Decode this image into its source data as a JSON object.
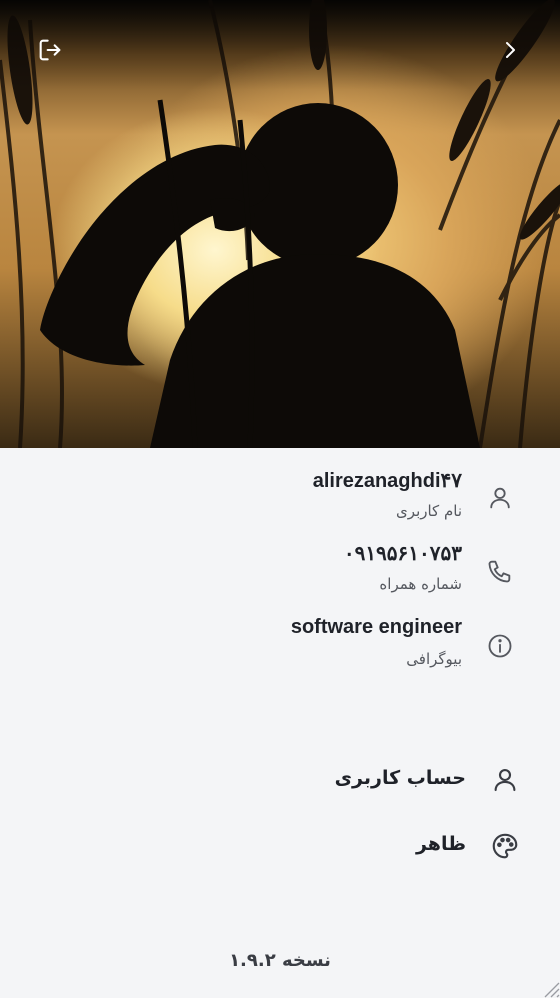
{
  "header": {
    "logout_icon": "logout-icon",
    "forward_icon": "chevron-right-icon"
  },
  "profile": {
    "username": {
      "value": "alirezanaghdi۴۷",
      "label": "نام کاربری",
      "icon": "user-icon"
    },
    "phone": {
      "value": "۰۹۱۹۵۶۱۰۷۵۳",
      "label": "شماره همراه",
      "icon": "phone-icon"
    },
    "bio": {
      "value": "software engineer",
      "label": "بیوگرافی",
      "icon": "info-icon"
    }
  },
  "menu": {
    "account": {
      "label": "حساب کاربری",
      "icon": "user-icon"
    },
    "appearance": {
      "label": "ظاهر",
      "icon": "palette-icon"
    }
  },
  "version": "نسخه ۱.۹.۲",
  "colors": {
    "background": "#f4f5f7",
    "text": "#1f2229",
    "secondary_text": "#55585f"
  }
}
